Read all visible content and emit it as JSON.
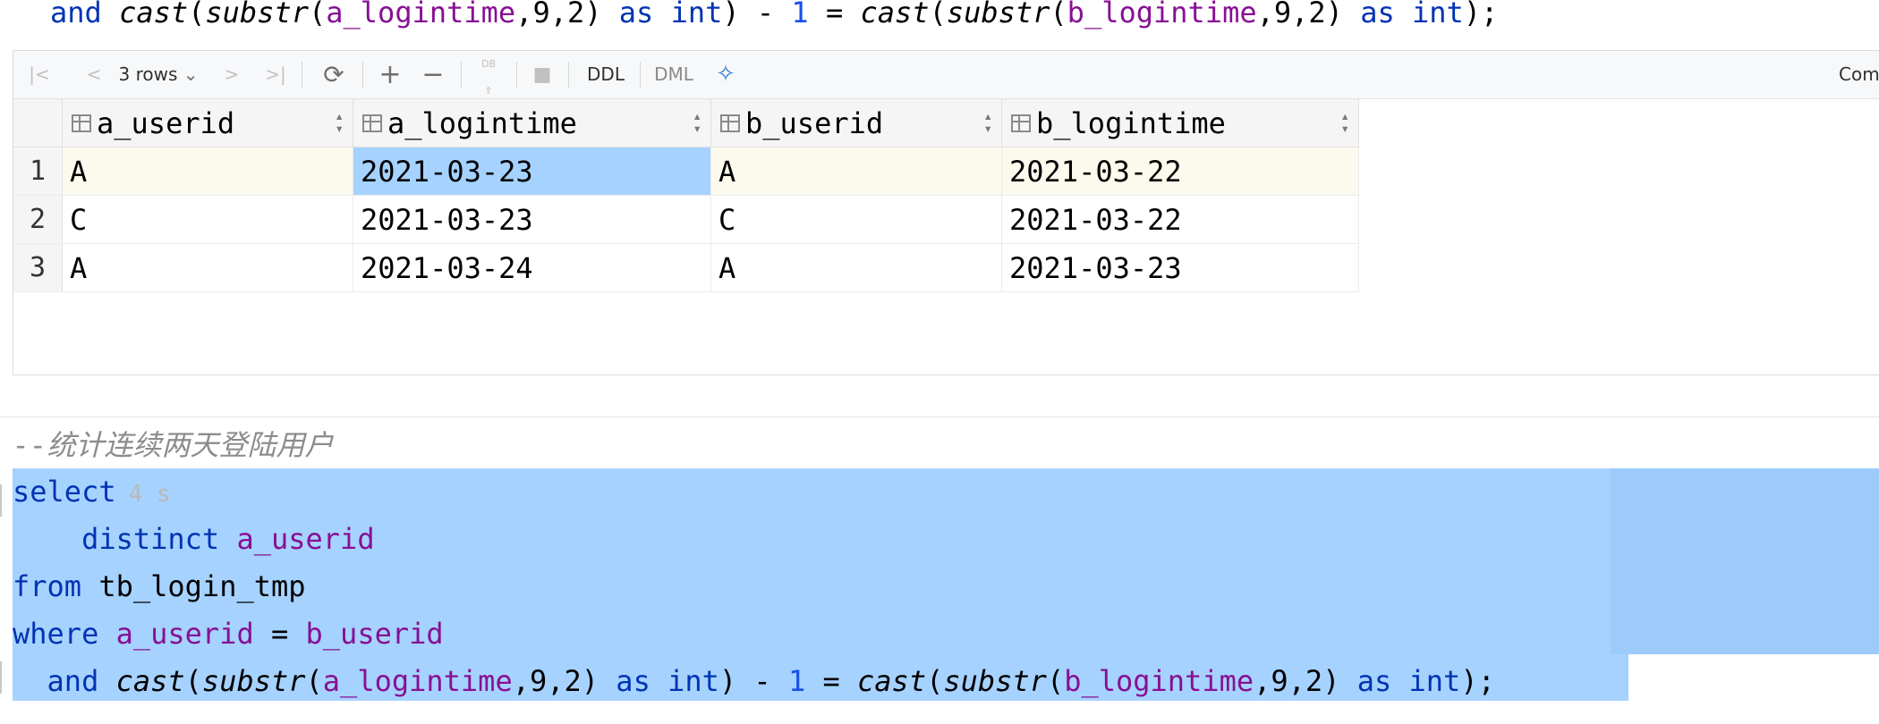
{
  "editor_top": {
    "line_and": "and",
    "fn_cast": "cast",
    "fn_substr": "substr",
    "col_a_logintime": "a_logintime",
    "col_b_logintime": "b_logintime",
    "args": ",9,2",
    "as_int": "as int",
    "minus": "-",
    "one": "1",
    "equals": "="
  },
  "toolbar": {
    "rows_label": "3 rows",
    "ddl_label": "DDL",
    "dml_label": "DML",
    "right_label": "Comi",
    "db_label": "DB"
  },
  "grid": {
    "columns": [
      "a_userid",
      "a_logintime",
      "b_userid",
      "b_logintime"
    ],
    "rows": [
      {
        "num": "1",
        "cells": [
          "A",
          "2021-03-23",
          "A",
          "2021-03-22"
        ]
      },
      {
        "num": "2",
        "cells": [
          "C",
          "2021-03-23",
          "C",
          "2021-03-22"
        ]
      },
      {
        "num": "3",
        "cells": [
          "A",
          "2021-03-24",
          "A",
          "2021-03-23"
        ]
      }
    ]
  },
  "query": {
    "comment": "--统计连续两天登陆用户",
    "select": "select",
    "exec_hint": "4 s",
    "distinct": "distinct",
    "from": "from",
    "table": "tb_login_tmp",
    "where": "where",
    "a_userid": "a_userid",
    "b_userid": "b_userid",
    "equals": "=",
    "and": "and",
    "cast": "cast",
    "substr": "substr",
    "a_logintime": "a_logintime",
    "b_logintime": "b_logintime",
    "args": ",9,2",
    "as_int": "as int",
    "minus": "-",
    "one": "1",
    "end": ";"
  },
  "colors": {
    "keyword": "#0033b3",
    "column": "#871094",
    "number": "#1750eb",
    "selection": "#a6d2ff"
  }
}
